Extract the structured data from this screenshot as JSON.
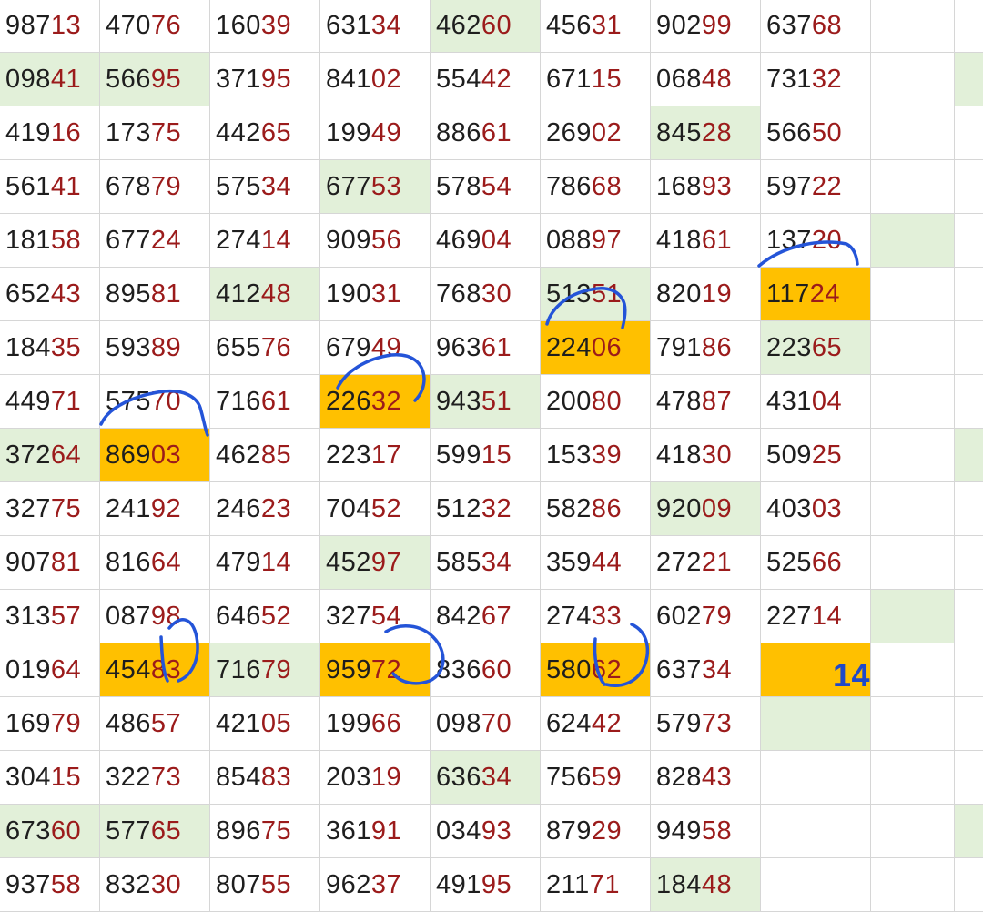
{
  "rows": [
    {
      "cells": [
        {
          "pre": "987",
          "suf": "13"
        },
        {
          "pre": "470",
          "suf": "76"
        },
        {
          "pre": "160",
          "suf": "39"
        },
        {
          "pre": "631",
          "suf": "34"
        },
        {
          "pre": "462",
          "suf": "60",
          "hl": "green"
        },
        {
          "pre": "456",
          "suf": "31"
        },
        {
          "pre": "902",
          "suf": "99"
        },
        {
          "pre": "637",
          "suf": "68"
        },
        {
          "pre": "",
          "suf": ""
        },
        {
          "pre": "",
          "suf": ""
        }
      ]
    },
    {
      "cells": [
        {
          "pre": "098",
          "suf": "41",
          "hl": "green"
        },
        {
          "pre": "566",
          "suf": "95",
          "hl": "green"
        },
        {
          "pre": "371",
          "suf": "95"
        },
        {
          "pre": "841",
          "suf": "02"
        },
        {
          "pre": "554",
          "suf": "42"
        },
        {
          "pre": "671",
          "suf": "15"
        },
        {
          "pre": "068",
          "suf": "48"
        },
        {
          "pre": "731",
          "suf": "32"
        },
        {
          "pre": "",
          "suf": ""
        },
        {
          "pre": "",
          "suf": "",
          "hl": "green"
        }
      ]
    },
    {
      "cells": [
        {
          "pre": "419",
          "suf": "16"
        },
        {
          "pre": "173",
          "suf": "75"
        },
        {
          "pre": "442",
          "suf": "65"
        },
        {
          "pre": "199",
          "suf": "49"
        },
        {
          "pre": "886",
          "suf": "61"
        },
        {
          "pre": "269",
          "suf": "02"
        },
        {
          "pre": "845",
          "suf": "28",
          "hl": "green"
        },
        {
          "pre": "566",
          "suf": "50"
        },
        {
          "pre": "",
          "suf": ""
        },
        {
          "pre": "",
          "suf": ""
        }
      ]
    },
    {
      "cells": [
        {
          "pre": "561",
          "suf": "41"
        },
        {
          "pre": "678",
          "suf": "79"
        },
        {
          "pre": "575",
          "suf": "34"
        },
        {
          "pre": "677",
          "suf": "53",
          "hl": "green"
        },
        {
          "pre": "578",
          "suf": "54"
        },
        {
          "pre": "786",
          "suf": "68"
        },
        {
          "pre": "168",
          "suf": "93"
        },
        {
          "pre": "597",
          "suf": "22"
        },
        {
          "pre": "",
          "suf": ""
        },
        {
          "pre": "",
          "suf": ""
        }
      ]
    },
    {
      "cells": [
        {
          "pre": "181",
          "suf": "58"
        },
        {
          "pre": "677",
          "suf": "24"
        },
        {
          "pre": "274",
          "suf": "14"
        },
        {
          "pre": "909",
          "suf": "56"
        },
        {
          "pre": "469",
          "suf": "04"
        },
        {
          "pre": "088",
          "suf": "97"
        },
        {
          "pre": "418",
          "suf": "61"
        },
        {
          "pre": "137",
          "suf": "20"
        },
        {
          "pre": "",
          "suf": "",
          "hl": "green"
        },
        {
          "pre": "",
          "suf": ""
        }
      ]
    },
    {
      "cells": [
        {
          "pre": "652",
          "suf": "43"
        },
        {
          "pre": "895",
          "suf": "81"
        },
        {
          "pre": "412",
          "suf": "48",
          "hl": "green"
        },
        {
          "pre": "190",
          "suf": "31"
        },
        {
          "pre": "768",
          "suf": "30"
        },
        {
          "pre": "513",
          "suf": "51",
          "hl": "green"
        },
        {
          "pre": "820",
          "suf": "19"
        },
        {
          "pre": "117",
          "suf": "24",
          "hl": "orange"
        },
        {
          "pre": "",
          "suf": ""
        },
        {
          "pre": "",
          "suf": ""
        }
      ]
    },
    {
      "cells": [
        {
          "pre": "184",
          "suf": "35"
        },
        {
          "pre": "593",
          "suf": "89"
        },
        {
          "pre": "655",
          "suf": "76"
        },
        {
          "pre": "679",
          "suf": "49"
        },
        {
          "pre": "963",
          "suf": "61"
        },
        {
          "pre": "224",
          "suf": "06",
          "hl": "orange"
        },
        {
          "pre": "791",
          "suf": "86"
        },
        {
          "pre": "223",
          "suf": "65",
          "hl": "green"
        },
        {
          "pre": "",
          "suf": ""
        },
        {
          "pre": "",
          "suf": ""
        }
      ]
    },
    {
      "cells": [
        {
          "pre": "449",
          "suf": "71"
        },
        {
          "pre": "575",
          "suf": "70"
        },
        {
          "pre": "716",
          "suf": "61"
        },
        {
          "pre": "226",
          "suf": "32",
          "hl": "orange"
        },
        {
          "pre": "943",
          "suf": "51",
          "hl": "green"
        },
        {
          "pre": "200",
          "suf": "80"
        },
        {
          "pre": "478",
          "suf": "87"
        },
        {
          "pre": "431",
          "suf": "04"
        },
        {
          "pre": "",
          "suf": ""
        },
        {
          "pre": "",
          "suf": ""
        }
      ]
    },
    {
      "cells": [
        {
          "pre": "372",
          "suf": "64",
          "hl": "green"
        },
        {
          "pre": "869",
          "suf": "03",
          "hl": "orange"
        },
        {
          "pre": "462",
          "suf": "85"
        },
        {
          "pre": "223",
          "suf": "17"
        },
        {
          "pre": "599",
          "suf": "15"
        },
        {
          "pre": "153",
          "suf": "39"
        },
        {
          "pre": "418",
          "suf": "30"
        },
        {
          "pre": "509",
          "suf": "25"
        },
        {
          "pre": "",
          "suf": ""
        },
        {
          "pre": "",
          "suf": "",
          "hl": "green"
        }
      ]
    },
    {
      "cells": [
        {
          "pre": "327",
          "suf": "75"
        },
        {
          "pre": "241",
          "suf": "92"
        },
        {
          "pre": "246",
          "suf": "23"
        },
        {
          "pre": "704",
          "suf": "52"
        },
        {
          "pre": "512",
          "suf": "32"
        },
        {
          "pre": "582",
          "suf": "86"
        },
        {
          "pre": "920",
          "suf": "09",
          "hl": "green"
        },
        {
          "pre": "403",
          "suf": "03"
        },
        {
          "pre": "",
          "suf": ""
        },
        {
          "pre": "",
          "suf": ""
        }
      ]
    },
    {
      "cells": [
        {
          "pre": "907",
          "suf": "81"
        },
        {
          "pre": "816",
          "suf": "64"
        },
        {
          "pre": "479",
          "suf": "14"
        },
        {
          "pre": "452",
          "suf": "97",
          "hl": "green"
        },
        {
          "pre": "585",
          "suf": "34"
        },
        {
          "pre": "359",
          "suf": "44"
        },
        {
          "pre": "272",
          "suf": "21"
        },
        {
          "pre": "525",
          "suf": "66"
        },
        {
          "pre": "",
          "suf": ""
        },
        {
          "pre": "",
          "suf": ""
        }
      ]
    },
    {
      "cells": [
        {
          "pre": "313",
          "suf": "57"
        },
        {
          "pre": "087",
          "suf": "98"
        },
        {
          "pre": "646",
          "suf": "52"
        },
        {
          "pre": "327",
          "suf": "54"
        },
        {
          "pre": "842",
          "suf": "67"
        },
        {
          "pre": "274",
          "suf": "33"
        },
        {
          "pre": "602",
          "suf": "79"
        },
        {
          "pre": "227",
          "suf": "14"
        },
        {
          "pre": "",
          "suf": "",
          "hl": "green"
        },
        {
          "pre": "",
          "suf": ""
        }
      ]
    },
    {
      "cells": [
        {
          "pre": "019",
          "suf": "64"
        },
        {
          "pre": "454",
          "suf": "83",
          "hl": "orange"
        },
        {
          "pre": "716",
          "suf": "79",
          "hl": "green"
        },
        {
          "pre": "959",
          "suf": "72",
          "hl": "orange"
        },
        {
          "pre": "836",
          "suf": "60"
        },
        {
          "pre": "580",
          "suf": "62",
          "hl": "orange"
        },
        {
          "pre": "637",
          "suf": "34"
        },
        {
          "pre": "",
          "suf": "",
          "hl": "orange",
          "count": "14"
        },
        {
          "pre": "",
          "suf": ""
        },
        {
          "pre": "",
          "suf": ""
        }
      ]
    },
    {
      "cells": [
        {
          "pre": "169",
          "suf": "79"
        },
        {
          "pre": "486",
          "suf": "57"
        },
        {
          "pre": "421",
          "suf": "05"
        },
        {
          "pre": "199",
          "suf": "66"
        },
        {
          "pre": "098",
          "suf": "70"
        },
        {
          "pre": "624",
          "suf": "42"
        },
        {
          "pre": "579",
          "suf": "73"
        },
        {
          "pre": "",
          "suf": "",
          "hl": "green"
        },
        {
          "pre": "",
          "suf": ""
        },
        {
          "pre": "",
          "suf": ""
        }
      ]
    },
    {
      "cells": [
        {
          "pre": "304",
          "suf": "15"
        },
        {
          "pre": "322",
          "suf": "73"
        },
        {
          "pre": "854",
          "suf": "83"
        },
        {
          "pre": "203",
          "suf": "19"
        },
        {
          "pre": "636",
          "suf": "34",
          "hl": "green"
        },
        {
          "pre": "756",
          "suf": "59"
        },
        {
          "pre": "828",
          "suf": "43"
        },
        {
          "pre": "",
          "suf": ""
        },
        {
          "pre": "",
          "suf": ""
        },
        {
          "pre": "",
          "suf": ""
        }
      ]
    },
    {
      "cells": [
        {
          "pre": "673",
          "suf": "60",
          "hl": "green"
        },
        {
          "pre": "577",
          "suf": "65",
          "hl": "green"
        },
        {
          "pre": "896",
          "suf": "75"
        },
        {
          "pre": "361",
          "suf": "91"
        },
        {
          "pre": "034",
          "suf": "93"
        },
        {
          "pre": "879",
          "suf": "29"
        },
        {
          "pre": "949",
          "suf": "58"
        },
        {
          "pre": "",
          "suf": ""
        },
        {
          "pre": "",
          "suf": ""
        },
        {
          "pre": "",
          "suf": "",
          "hl": "green"
        }
      ]
    },
    {
      "cells": [
        {
          "pre": "937",
          "suf": "58"
        },
        {
          "pre": "832",
          "suf": "30"
        },
        {
          "pre": "807",
          "suf": "55"
        },
        {
          "pre": "962",
          "suf": "37"
        },
        {
          "pre": "491",
          "suf": "95"
        },
        {
          "pre": "211",
          "suf": "71"
        },
        {
          "pre": "184",
          "suf": "48",
          "hl": "green"
        },
        {
          "pre": "",
          "suf": ""
        },
        {
          "pre": "",
          "suf": ""
        },
        {
          "pre": "",
          "suf": ""
        }
      ]
    }
  ]
}
